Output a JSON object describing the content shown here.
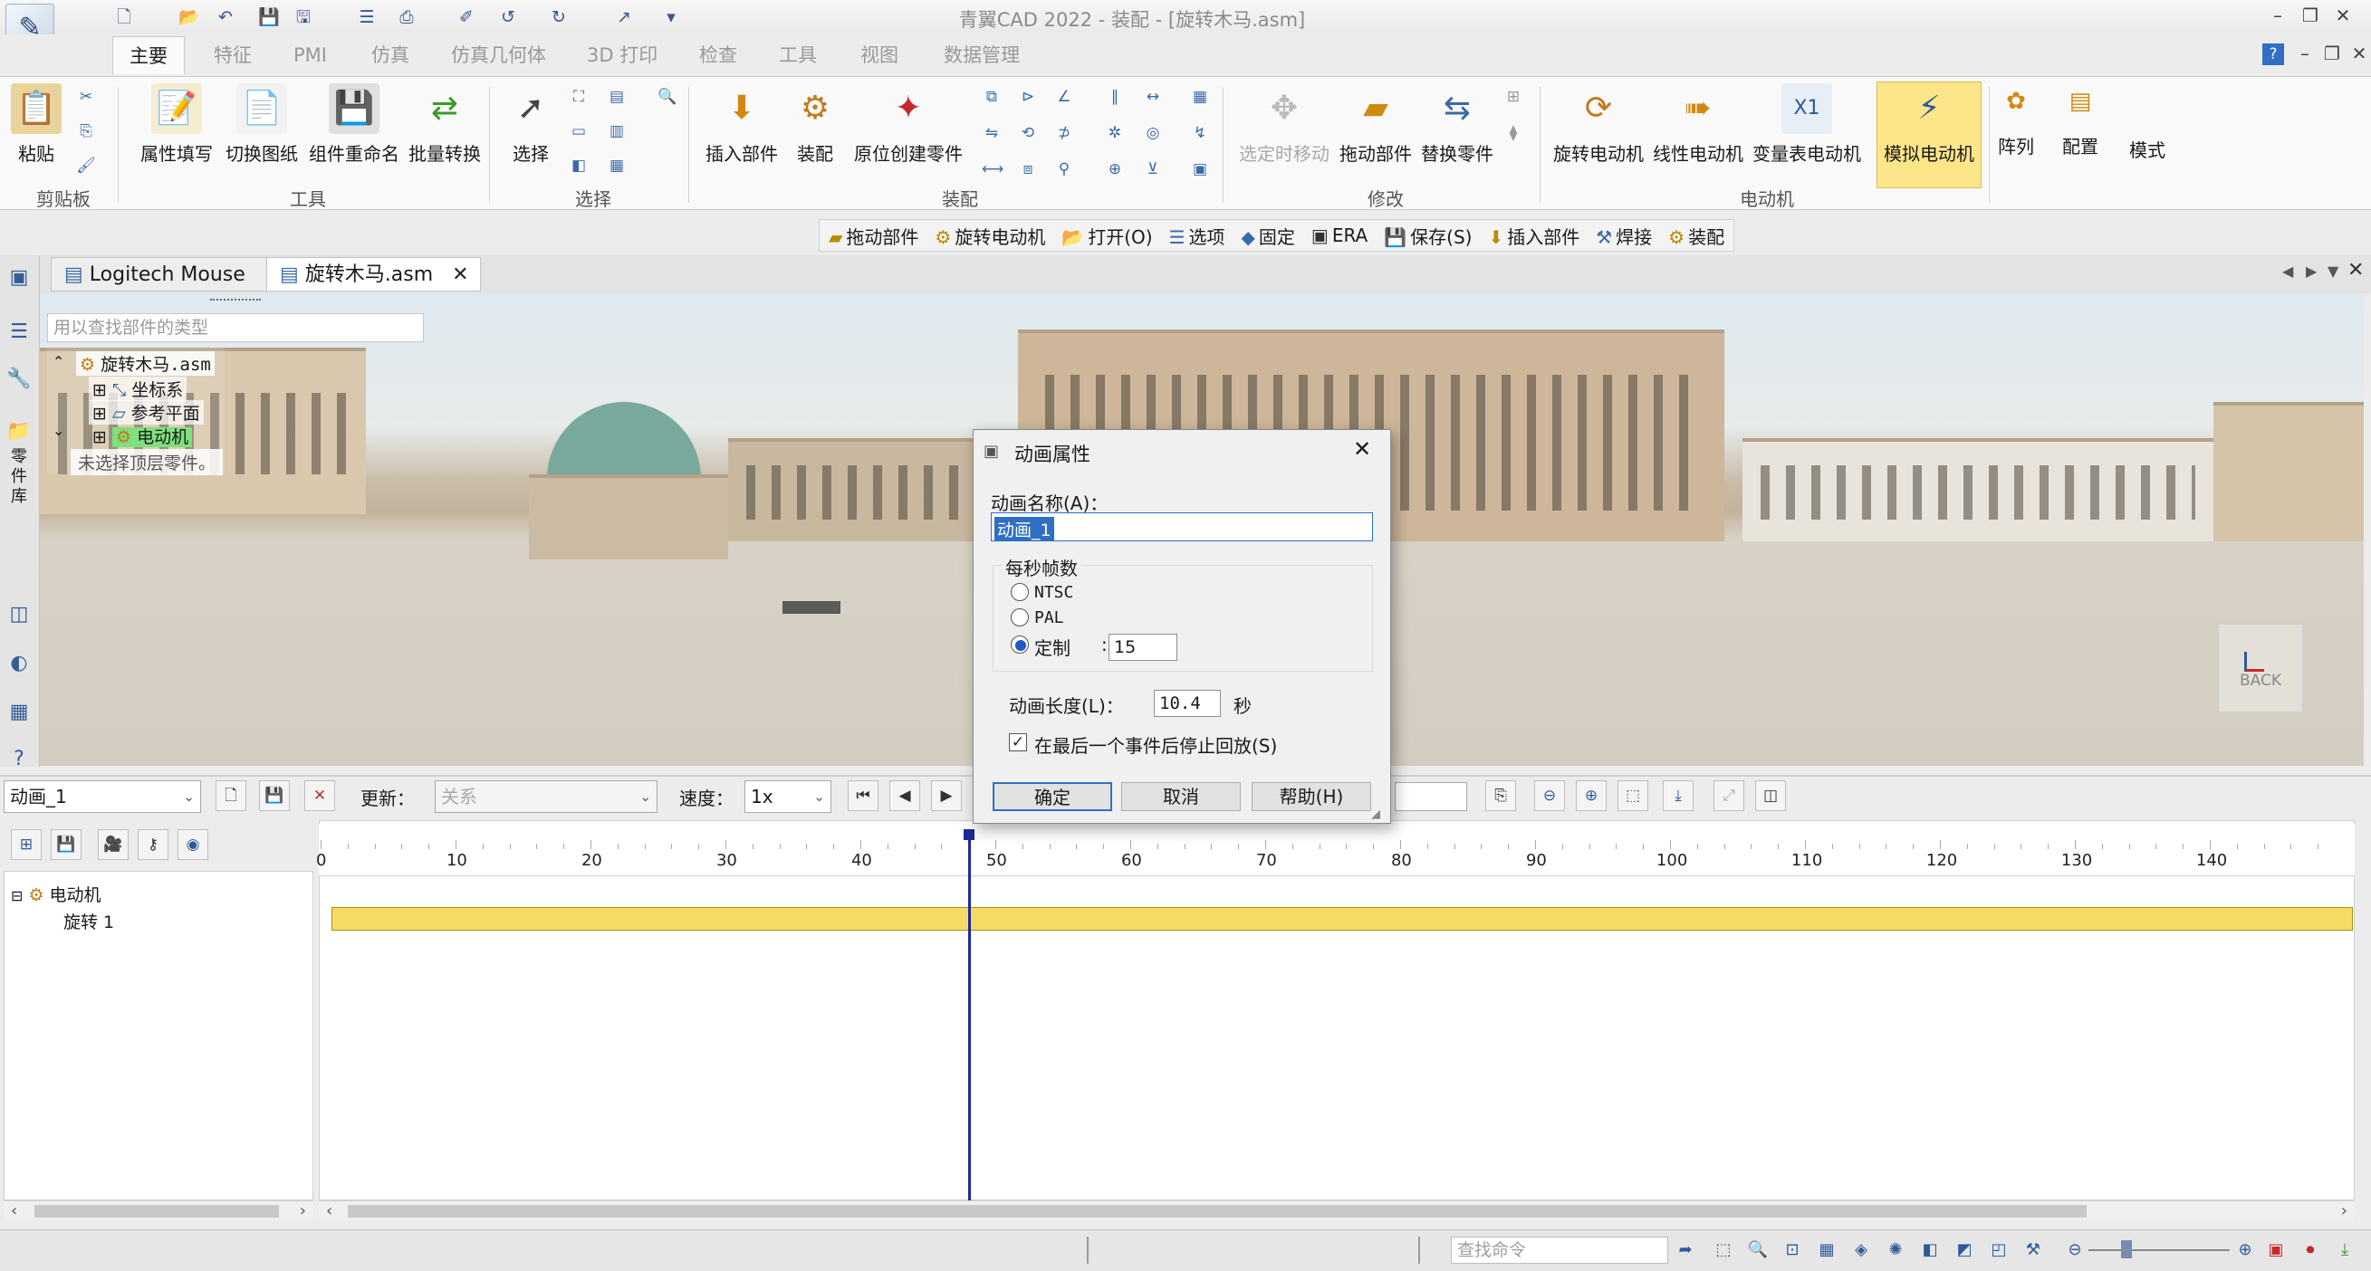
{
  "window": {
    "title": "青翼CAD 2022 - 装配 - [旋转木马.asm]",
    "help_label": "?"
  },
  "ribbon_tabs": [
    "主要",
    "特征",
    "PMI",
    "仿真",
    "仿真几何体",
    "3D 打印",
    "检查",
    "工具",
    "视图",
    "数据管理"
  ],
  "ribbon": {
    "clipboard": {
      "paste": "粘贴",
      "group": "剪贴板"
    },
    "tools": {
      "attr_fill": "属性填写",
      "switch_drawing": "切换图纸",
      "rename_component": "组件重命名",
      "batch_convert": "批量转换",
      "group": "工具"
    },
    "select": {
      "select": "选择",
      "group": "选择"
    },
    "assembly": {
      "insert_part": "插入部件",
      "assemble": "装配",
      "in_place_create": "原位创建零件",
      "group": "装配"
    },
    "modify": {
      "move_when_selected": "选定时移动",
      "drag_part": "拖动部件",
      "replace_part": "替换零件",
      "group": "修改"
    },
    "motor": {
      "rotary": "旋转电动机",
      "linear": "线性电动机",
      "variable": "变量表电动机",
      "simulate": "模拟电动机",
      "group": "电动机"
    },
    "pattern": "阵列",
    "config": "配置",
    "mode": "模式"
  },
  "command_bar": [
    "拖动部件",
    "旋转电动机",
    "打开(O)",
    "选项",
    "固定",
    "ERA",
    "保存(S)",
    "插入部件",
    "焊接",
    "装配"
  ],
  "doc_tabs": [
    {
      "label": "Logitech Mouse",
      "active": false
    },
    {
      "label": "旋转木马.asm",
      "active": true
    }
  ],
  "feature_tree": {
    "search_placeholder": "用以查找部件的类型",
    "root": "旋转木马.asm",
    "children": [
      "坐标系",
      "参考平面",
      "电动机"
    ],
    "hint": "未选择顶层零件。"
  },
  "side_tab": "零件库",
  "view_cube_label": "BACK",
  "dialog": {
    "title": "动画属性",
    "name_label": "动画名称(A)：",
    "name_value": "动画_1",
    "fps_group": "每秒帧数",
    "fps_options": [
      "NTSC",
      "PAL",
      "定制"
    ],
    "fps_selected": "定制",
    "fps_custom_value": "15",
    "length_label": "动画长度(L)：",
    "length_value": "10.4",
    "length_unit": "秒",
    "stop_label": "在最后一个事件后停止回放(S)",
    "stop_checked": true,
    "ok": "确定",
    "cancel": "取消",
    "help": "帮助(H)"
  },
  "anim_toolbar": {
    "animation_select": "动画_1",
    "update_label": "更新：",
    "update_value": "关系",
    "speed_label": "速度：",
    "speed_value": "1x"
  },
  "anim_tree": {
    "root": "电动机",
    "child": "旋转 1"
  },
  "timeline": {
    "ticks": [
      "0",
      "10",
      "20",
      "30",
      "40",
      "50",
      "60",
      "70",
      "80",
      "90",
      "100",
      "110",
      "120",
      "130",
      "140"
    ],
    "playhead_frame": 48,
    "max_frame": 149
  },
  "status": {
    "command_placeholder": "查找命令"
  }
}
